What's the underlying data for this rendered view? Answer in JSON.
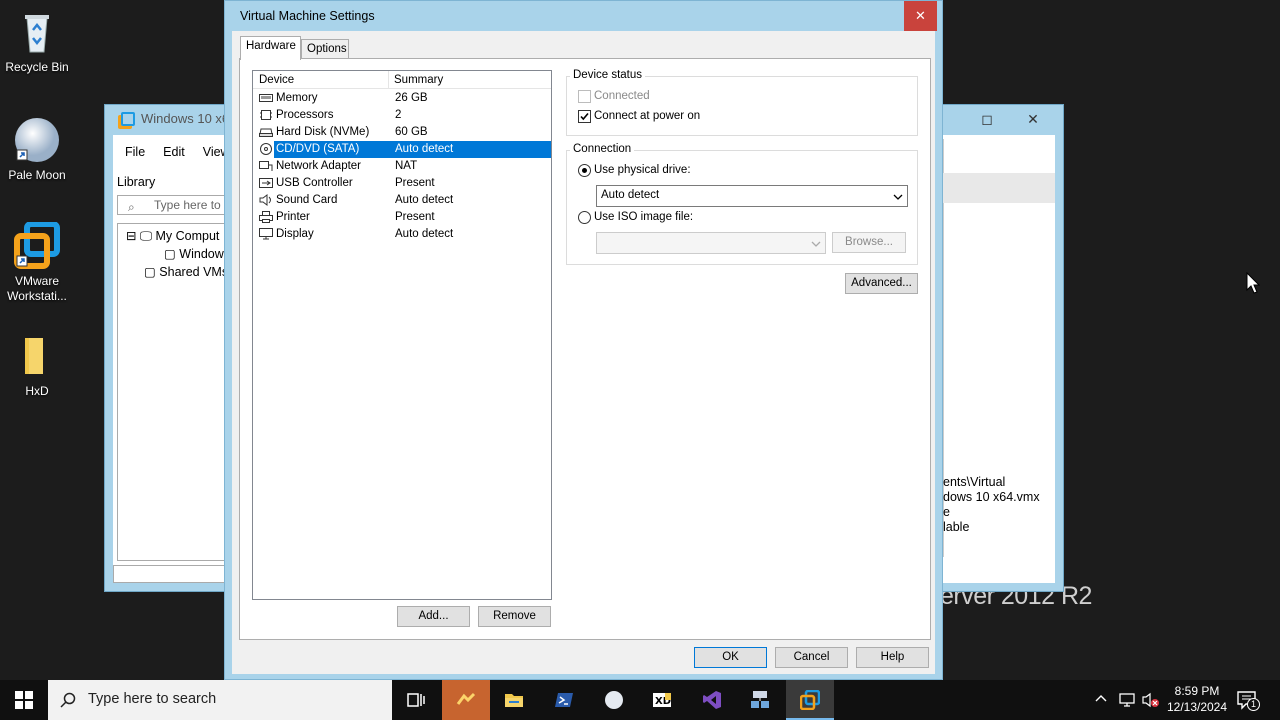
{
  "desktop": {
    "icons": [
      {
        "label": "Recycle Bin",
        "icon": "recycle-bin-icon"
      },
      {
        "label": "Pale Moon",
        "icon": "pale-moon-icon"
      },
      {
        "label": "VMware Workstati...",
        "icon": "vmware-icon"
      },
      {
        "label": "HxD",
        "icon": "folder-icon"
      }
    ],
    "watermark": "erver 2012 R2"
  },
  "background_window": {
    "title": "Windows 10 x64",
    "menu": [
      "File",
      "Edit",
      "View"
    ],
    "library_label": "Library",
    "search_placeholder": "Type here to s",
    "tree": [
      "My Comput",
      "Window",
      "Shared VMs"
    ],
    "details": [
      "ents\\Virtual",
      "dows 10 x64.vmx",
      "e",
      "lable"
    ]
  },
  "dialog": {
    "title": "Virtual Machine Settings",
    "close": "✕",
    "tabs": [
      "Hardware",
      "Options"
    ],
    "columns": {
      "device": "Device",
      "summary": "Summary"
    },
    "devices": [
      {
        "name": "Memory",
        "summary": "26 GB",
        "icon": "memory-icon"
      },
      {
        "name": "Processors",
        "summary": "2",
        "icon": "processor-icon"
      },
      {
        "name": "Hard Disk (NVMe)",
        "summary": "60 GB",
        "icon": "hard-disk-icon"
      },
      {
        "name": "CD/DVD (SATA)",
        "summary": "Auto detect",
        "icon": "cd-dvd-icon",
        "selected": true
      },
      {
        "name": "Network Adapter",
        "summary": "NAT",
        "icon": "network-adapter-icon"
      },
      {
        "name": "USB Controller",
        "summary": "Present",
        "icon": "usb-icon"
      },
      {
        "name": "Sound Card",
        "summary": "Auto detect",
        "icon": "sound-card-icon"
      },
      {
        "name": "Printer",
        "summary": "Present",
        "icon": "printer-icon"
      },
      {
        "name": "Display",
        "summary": "Auto detect",
        "icon": "display-icon"
      }
    ],
    "add_button": "Add...",
    "remove_button": "Remove",
    "device_status": {
      "label": "Device status",
      "connected": {
        "label": "Connected",
        "checked": false,
        "enabled": false
      },
      "connect_at_power_on": {
        "label": "Connect at power on",
        "checked": true
      }
    },
    "connection": {
      "label": "Connection",
      "physical": {
        "label": "Use physical drive:",
        "selected": true
      },
      "physical_value": "Auto detect",
      "iso": {
        "label": "Use ISO image file:",
        "selected": false
      },
      "iso_value": "",
      "browse_button": "Browse..."
    },
    "advanced_button": "Advanced...",
    "ok_button": "OK",
    "cancel_button": "Cancel",
    "help_button": "Help"
  },
  "taskbar": {
    "search_placeholder": "Type here to search",
    "clock_time": "8:59 PM",
    "clock_date": "12/13/2024",
    "notification_count": "1"
  }
}
